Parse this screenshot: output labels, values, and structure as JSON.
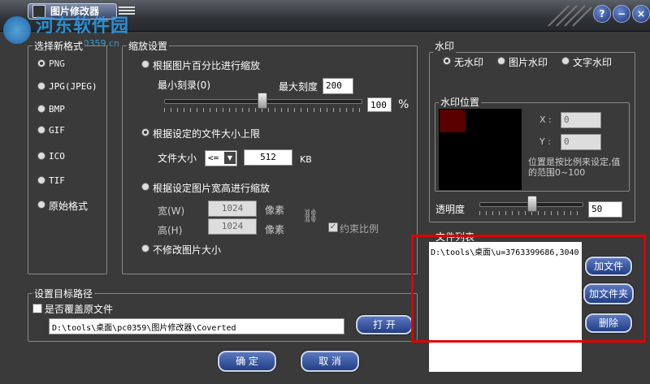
{
  "titlebar": {
    "title": "图片修改器"
  },
  "watermark": {
    "site": "河东软件园",
    "url": "www.pc0359.cn"
  },
  "format": {
    "label": "选择新格式",
    "options": [
      "PNG",
      "JPG(JPEG)",
      "BMP",
      "GIF",
      "ICO",
      "TIF",
      "原始格式"
    ],
    "selected": "PNG"
  },
  "scale": {
    "label": "缩放设置",
    "percent_option": "根据图片百分比进行缩放",
    "min_label": "最小刻录(0)",
    "max_label": "最大刻度",
    "max_value": "200",
    "percent_value": "100",
    "percent_unit": "%",
    "percent_slider": 0.5,
    "filesize_option": "根据设定的文件大小上限",
    "filesize_label": "文件大小",
    "operator": "<=",
    "filesize_value": "512",
    "filesize_unit": "KB",
    "wh_option": "根据设定图片宽高进行缩放",
    "width_label": "宽(W)",
    "width_value": "1024",
    "width_unit": "像素",
    "height_label": "高(H)",
    "height_value": "1024",
    "height_unit": "像素",
    "keep_ratio": "约束比例",
    "none_option": "不修改图片大小",
    "selected": "filesize"
  },
  "target": {
    "label": "设置目标路径",
    "overwrite": "是否覆盖原文件",
    "path": "D:\\tools\\桌面\\pc0359\\图片修改器\\Coverted",
    "open_button": "打 开"
  },
  "watermark_settings": {
    "label": "水印",
    "options": [
      "无水印",
      "图片水印",
      "文字水印"
    ],
    "selected": "无水印",
    "position_label": "水印位置",
    "x_label": "X :",
    "x_value": "0",
    "y_label": "Y :",
    "y_value": "0",
    "note": "位置是按比例来设定,值的范围0~100",
    "opacity_label": "透明度",
    "opacity_value": "50",
    "opacity_slider": 0.5
  },
  "filelist": {
    "label": "文件列表",
    "items": [
      "D:\\tools\\桌面\\u=3763399686,3040"
    ],
    "add_file": "加文件",
    "add_folder": "加文件夹",
    "delete": "删除"
  },
  "footer": {
    "ok": "确 定",
    "cancel": "取 消"
  },
  "colors": {
    "accent_button": "#2e4c98",
    "highlight": "#e00000",
    "marker": "#5a0000"
  }
}
